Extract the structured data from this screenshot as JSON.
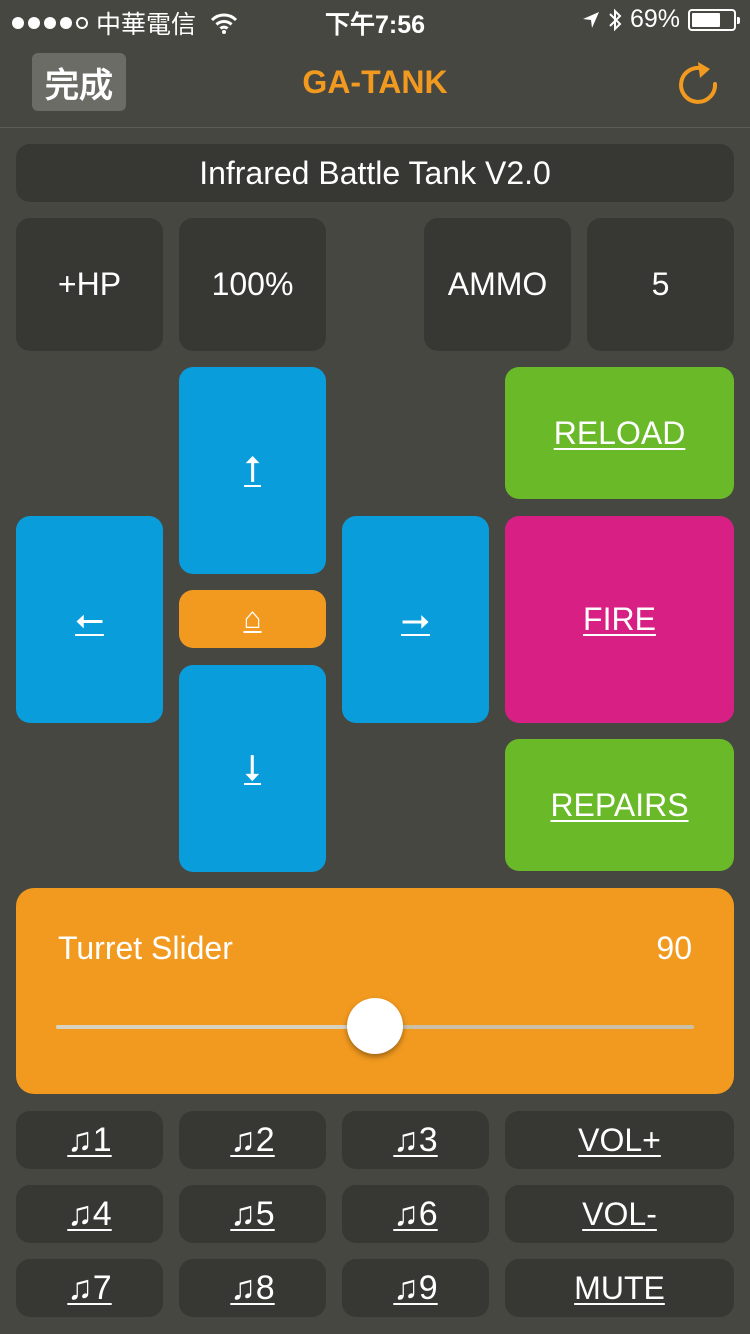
{
  "status_bar": {
    "carrier": "中華電信",
    "time": "下午7:56",
    "battery": "69%",
    "battery_level": 0.69
  },
  "nav": {
    "done_label": "完成",
    "title": "GA-TANK",
    "refresh_icon": "refresh-icon"
  },
  "device_name": "Infrared Battle Tank V2.0",
  "stats": {
    "hp_label": "+HP",
    "hp_value": "100%",
    "ammo_label": "AMMO",
    "ammo_value": "5"
  },
  "dpad": {
    "up": "⭡",
    "down": "⭣",
    "left": "⭠",
    "right": "⭢",
    "home": "⌂"
  },
  "actions": {
    "reload": "RELOAD",
    "fire": "FIRE",
    "repairs": "REPAIRS"
  },
  "turret": {
    "label": "Turret Slider",
    "value": "90",
    "min": 0,
    "max": 180,
    "level": 90
  },
  "sound_buttons": [
    "♫1",
    "♫2",
    "♫3",
    "♫4",
    "♫5",
    "♫6",
    "♫7",
    "♫8",
    "♫9"
  ],
  "volume": {
    "up": "VOL+",
    "down": "VOL-",
    "mute": "MUTE"
  },
  "colors": {
    "background": "#474741",
    "accent": "#f29a1f",
    "dpad": "#0a9ddb",
    "green": "#69b928",
    "fire": "#d81f84",
    "panel": "#373733"
  }
}
